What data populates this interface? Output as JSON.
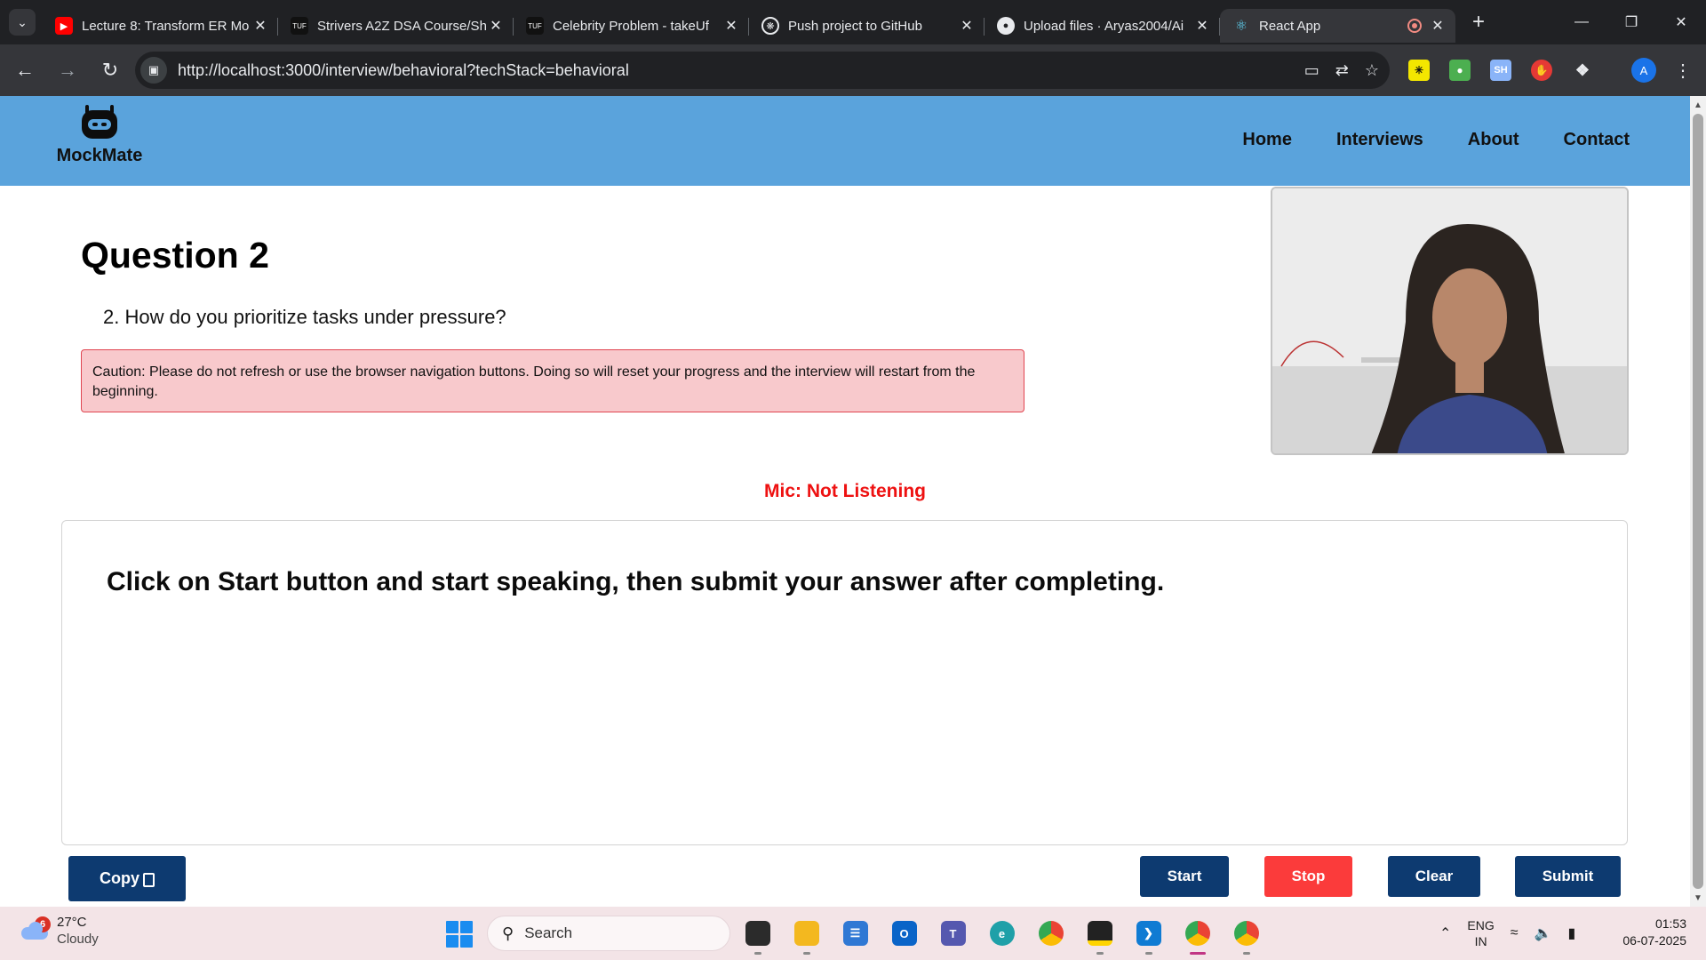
{
  "browser": {
    "tabs": [
      {
        "title": "Lecture 8: Transform ER Mo",
        "favicon": "youtube-icon",
        "color": "#ff0000"
      },
      {
        "title": "Strivers A2Z DSA Course/Sh",
        "favicon": "tuf-icon",
        "color": "#000000"
      },
      {
        "title": "Celebrity Problem - takeUf",
        "favicon": "tuf-icon",
        "color": "#000000"
      },
      {
        "title": "Push project to GitHub",
        "favicon": "openai-icon",
        "color": "#ffffff"
      },
      {
        "title": "Upload files · Aryas2004/Ai",
        "favicon": "github-icon",
        "color": "#ffffff"
      },
      {
        "title": "React App",
        "favicon": "react-icon",
        "color": "#61dafb",
        "active": true
      }
    ],
    "url": "http://localhost:3000/interview/behavioral?techStack=behavioral",
    "profile_initial": "A"
  },
  "site": {
    "brand": "MockMate",
    "nav": [
      "Home",
      "Interviews",
      "About",
      "Contact"
    ],
    "header_color": "#5aa3dc"
  },
  "question": {
    "title": "Question 2",
    "text": "2. How do you prioritize tasks under pressure?"
  },
  "caution": "Caution: Please do not refresh or use the browser navigation buttons. Doing so will reset your progress and the interview will restart from the beginning.",
  "mic_status": "Mic: Not Listening",
  "answer_prompt": "Click on Start button and start speaking, then submit your answer after completing.",
  "buttons": {
    "copy": "Copy",
    "start": "Start",
    "stop": "Stop",
    "clear": "Clear",
    "submit": "Submit"
  },
  "colors": {
    "primary_button": "#0d3a70",
    "stop_button": "#fb3b3b",
    "mic_status": "#ee1111",
    "caution_bg": "#f8c9cc"
  },
  "taskbar": {
    "weather": {
      "temp": "27°C",
      "condition": "Cloudy",
      "badge": "6"
    },
    "search_placeholder": "Search",
    "language": {
      "line1": "ENG",
      "line2": "IN"
    },
    "time": "01:53",
    "date": "06-07-2025"
  }
}
